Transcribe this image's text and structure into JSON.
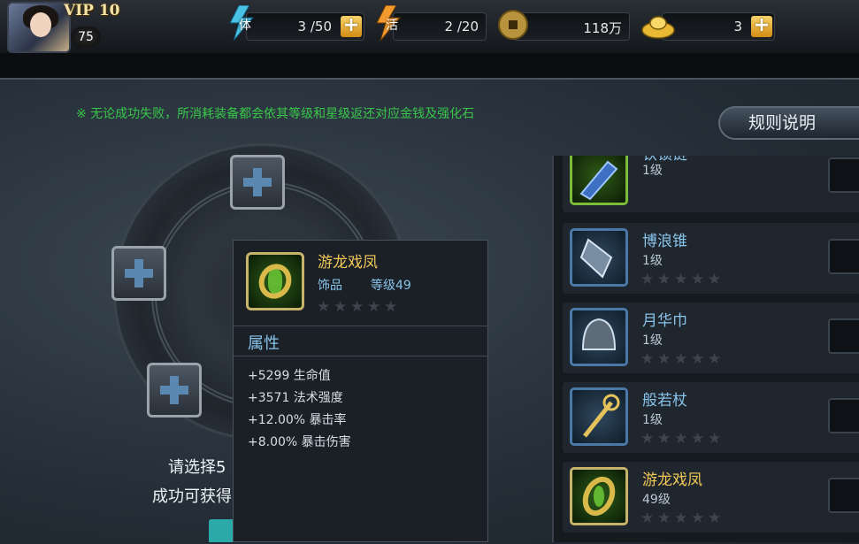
{
  "header": {
    "vip": "VIP 10",
    "player_level": "75",
    "stamina": {
      "label": "体",
      "value": "3 /50"
    },
    "activity": {
      "label": "活",
      "value": "2 /20"
    },
    "coins": {
      "value": "118万"
    },
    "gold": {
      "value": "3"
    },
    "plus": "+"
  },
  "notice": "※ 无论成功失败，所消耗装备都会依其等级和星级返还对应金钱及强化石",
  "rule_button": "规则说明",
  "hints": {
    "line1": "请选择5",
    "line2": "成功可获得"
  },
  "tooltip": {
    "name": "游龙戏凤",
    "type": "饰品",
    "level": "等级49",
    "stars": 0,
    "attr_title": "属性",
    "attrs": [
      "+5299 生命值",
      "+3571 法术强度",
      "+12.00% 暴击率",
      "+8.00% 暴击伤害"
    ]
  },
  "items": [
    {
      "name": "铁锁链",
      "level": "1级",
      "style": "green"
    },
    {
      "name": "博浪锥",
      "level": "1级",
      "style": "blue"
    },
    {
      "name": "月华巾",
      "level": "1级",
      "style": "blue"
    },
    {
      "name": "般若杖",
      "level": "1级",
      "style": "blue"
    },
    {
      "name": "游龙戏凤",
      "level": "49级",
      "style": "gold"
    }
  ],
  "colors": {
    "accent_gold": "#f2c957",
    "accent_blue": "#88c3ea",
    "notice_green": "#39c64a",
    "plus_orange": "#d28b14"
  },
  "icons": [
    "stamina-bolt-icon",
    "activity-bolt-icon",
    "coin-icon",
    "gold-ingot-icon",
    "plus-slot-icon",
    "star-icon"
  ]
}
